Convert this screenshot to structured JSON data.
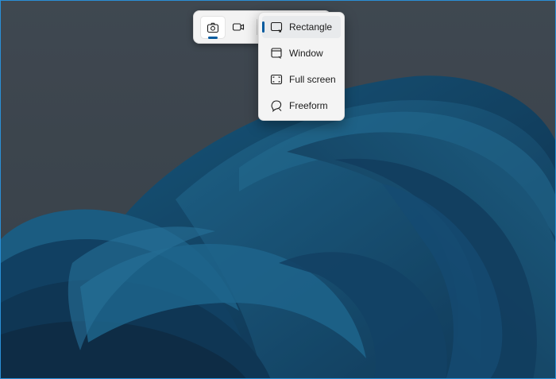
{
  "snip_toolbar": {
    "modes": [
      {
        "icon": "camera-icon",
        "selected": true
      },
      {
        "icon": "video-camera-icon",
        "selected": false
      }
    ]
  },
  "snip_mode_menu": {
    "items": [
      {
        "label": "Rectangle",
        "icon": "rectangle-snip-icon",
        "selected": true
      },
      {
        "label": "Window",
        "icon": "window-snip-icon",
        "selected": false
      },
      {
        "label": "Full screen",
        "icon": "fullscreen-snip-icon",
        "selected": false
      },
      {
        "label": "Freeform",
        "icon": "freeform-snip-icon",
        "selected": false
      }
    ]
  },
  "colors": {
    "accent": "#005a9e",
    "screen_border": "#2a8fd6",
    "desktop_gray": "#3e4a55",
    "bloom_blue": "#0f5e8a"
  }
}
